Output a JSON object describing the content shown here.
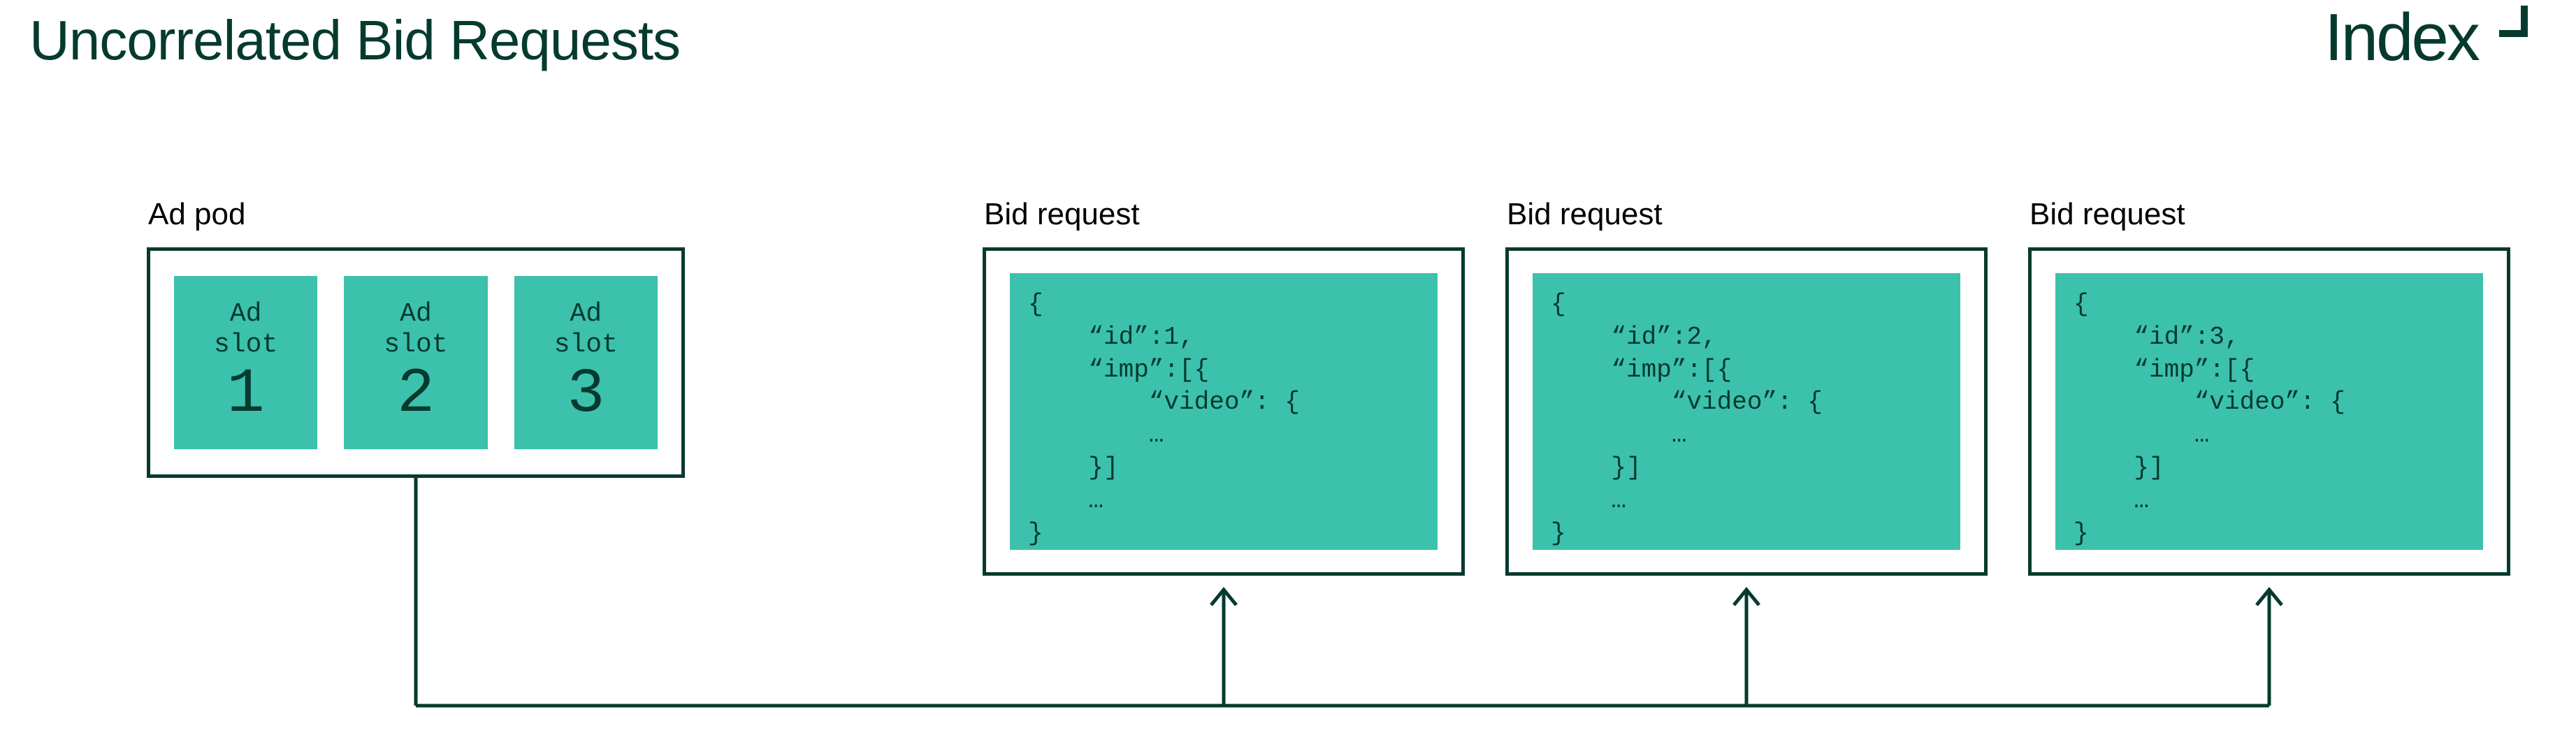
{
  "title": "Uncorrelated Bid Requests",
  "brand": "Index",
  "adpod": {
    "label": "Ad pod",
    "slots": [
      {
        "label": "Ad\nslot",
        "number": "1"
      },
      {
        "label": "Ad\nslot",
        "number": "2"
      },
      {
        "label": "Ad\nslot",
        "number": "3"
      }
    ]
  },
  "bids": [
    {
      "label": "Bid request",
      "code": "{\n    “id”:1,\n    “imp”:[{\n        “video”: {\n        …\n    }]\n    …\n}"
    },
    {
      "label": "Bid request",
      "code": "{\n    “id”:2,\n    “imp”:[{\n        “video”: {\n        …\n    }]\n    …\n}"
    },
    {
      "label": "Bid request",
      "code": "{\n    “id”:3,\n    “imp”:[{\n        “video”: {\n        …\n    }]\n    …\n}"
    }
  ]
}
